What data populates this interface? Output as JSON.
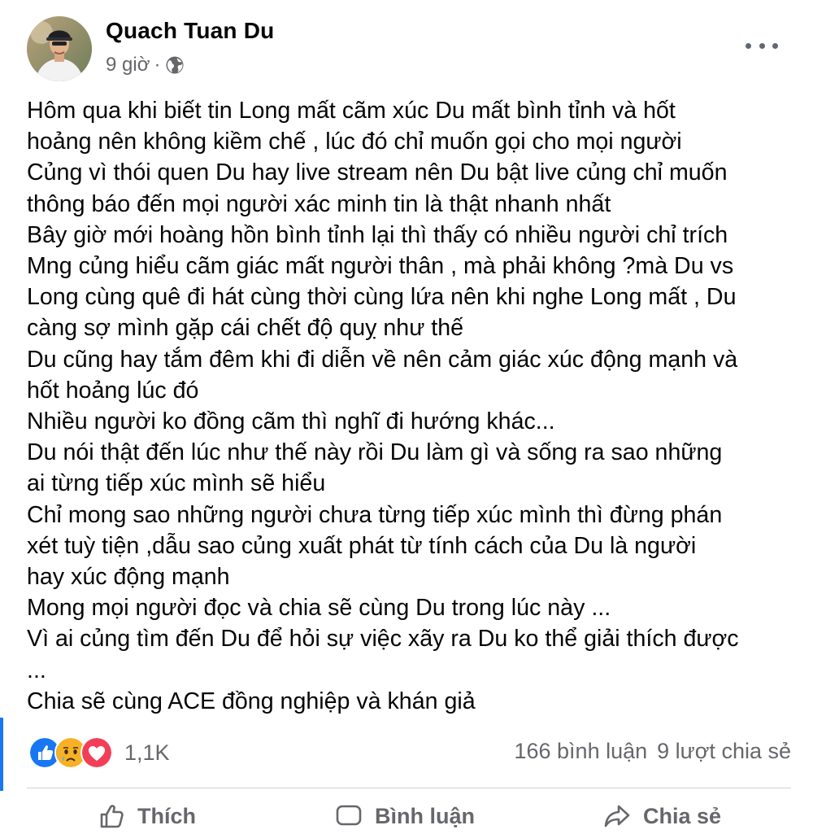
{
  "post": {
    "author": "Quach Tuan Du",
    "time": "9 giờ",
    "separator": "·",
    "audience_icon": "globe-icon",
    "lines": [
      "Hôm qua khi biết tin Long mất cãm xúc Du mất bình tỉnh và hốt",
      "hoảng nên không kiềm chế , lúc đó chỉ muốn gọi cho mọi người",
      "Củng vì thói quen Du hay live stream nên Du bật live củng chỉ muốn",
      "thông báo đến mọi người xác minh tin là thật nhanh nhất",
      "Bây giờ mới hoàng hồn bình tỉnh lại thì thấy có nhiều người chỉ trích",
      "Mng củng hiểu cãm giác mất người thân , mà phải không ?mà Du vs",
      "Long cùng quê đi hát cùng thời cùng lứa nên khi nghe Long mất , Du",
      "càng sợ mình gặp cái chết độ quỵ như thế",
      "Du cũng hay tắm đêm khi đi diễn về nên cảm giác xúc động mạnh và",
      "hốt hoảng lúc đó",
      "Nhiều người ko đồng cãm thì nghĩ đi hướng khác...",
      "Du nói thật đến lúc như thế này rồi Du làm gì và sống ra sao những",
      "ai từng tiếp xúc mình sẽ hiểu",
      "Chỉ mong sao những người chưa từng tiếp xúc mình thì đừng phán",
      "xét tuỳ tiện ,dẫu sao củng xuất phát từ tính cách của Du là người",
      "hay xúc động mạnh",
      "Mong mọi người đọc và chia sẽ cùng Du trong lúc này ...",
      "Vì ai củng tìm đến Du để hỏi sự việc xãy ra Du ko thể giải thích được",
      "...",
      "Chia sẽ cùng ACE đồng nghiệp và khán giả"
    ],
    "reactions": {
      "icons": [
        "like-icon",
        "sad-icon",
        "love-icon"
      ],
      "count": "1,1K"
    },
    "stats": {
      "comments": "166 bình luận",
      "shares": "9 lượt chia sẻ"
    },
    "actions": {
      "like": "Thích",
      "comment": "Bình luận",
      "share": "Chia sẻ"
    }
  },
  "colors": {
    "brand_blue": "#1877f2",
    "text_primary": "#050505",
    "text_secondary": "#65676b",
    "love_red": "#f33e58",
    "sad_yellow": "#f7b125"
  }
}
